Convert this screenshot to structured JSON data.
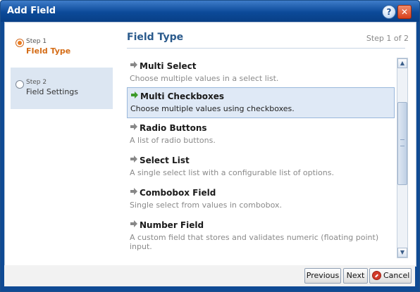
{
  "dialog": {
    "title": "Add Field"
  },
  "titlebar": {
    "help_glyph": "?",
    "close_glyph": "✕"
  },
  "sidebar": {
    "steps": [
      {
        "small": "Step 1",
        "label": "FIeld Type",
        "active": true
      },
      {
        "small": "Step 2",
        "label": "Field Settings",
        "active": false
      }
    ]
  },
  "panel": {
    "title": "Field Type",
    "step_indicator": "Step 1 of 2"
  },
  "field_types": [
    {
      "title": "Multi Select",
      "desc": "Choose multiple values in a select list."
    },
    {
      "title": "Multi Checkboxes",
      "desc": "Choose multiple values using checkboxes.",
      "selected": true
    },
    {
      "title": "Radio Buttons",
      "desc": "A list of radio buttons."
    },
    {
      "title": "Select List",
      "desc": "A single select list with a configurable list of options."
    },
    {
      "title": "Combobox Field",
      "desc": "Single select from values in combobox."
    },
    {
      "title": "Number Field",
      "desc": "A custom field that stores and validates numeric (floating point) input."
    }
  ],
  "scrollbar": {
    "up_glyph": "▲",
    "down_glyph": "▼"
  },
  "footer": {
    "previous": "Previous",
    "next": "Next",
    "cancel": "Cancel"
  },
  "colors": {
    "accent_step": "#e97b1f",
    "arrow_default": "#888888",
    "arrow_selected": "#3c9a2a",
    "selected_bg": "#dfe9f6"
  },
  "icons": {
    "item_arrow": "arrow-right-icon",
    "help": "help-icon",
    "close": "close-icon",
    "cancel": "cancel-icon"
  }
}
